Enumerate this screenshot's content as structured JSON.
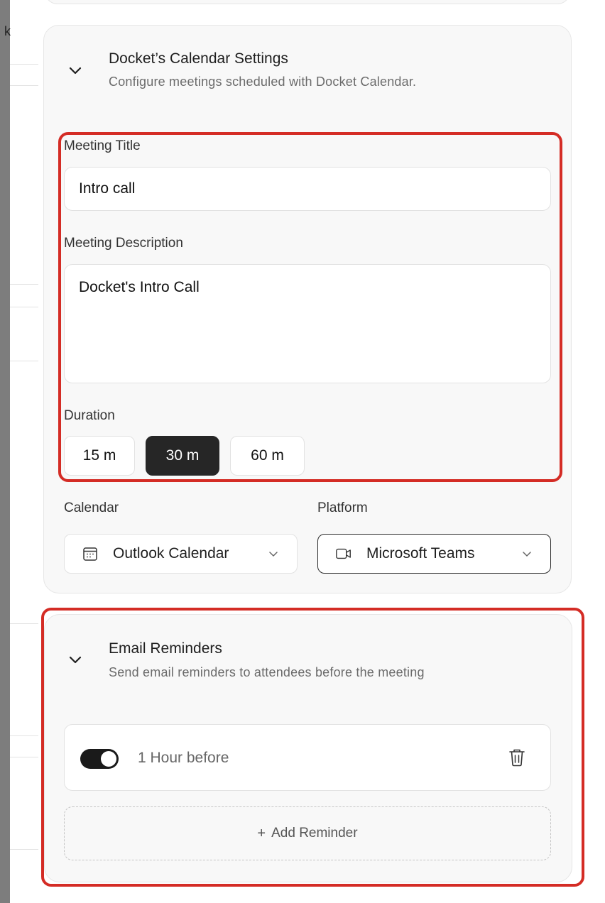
{
  "left_strip": {
    "text": "k"
  },
  "calendar_settings": {
    "title": "Docket’s Calendar Settings",
    "subtitle": "Configure meetings scheduled with Docket Calendar.",
    "meeting_title": {
      "label": "Meeting Title",
      "value": "Intro call"
    },
    "meeting_description": {
      "label": "Meeting Description",
      "value": "Docket's Intro Call"
    },
    "duration": {
      "label": "Duration",
      "options": [
        "15 m",
        "30 m",
        "60 m"
      ],
      "selected": "30 m"
    },
    "calendar": {
      "label": "Calendar",
      "value": "Outlook Calendar"
    },
    "platform": {
      "label": "Platform",
      "value": "Microsoft Teams"
    }
  },
  "email_reminders": {
    "title": "Email Reminders",
    "subtitle": "Send email reminders to attendees before the meeting",
    "reminders": [
      {
        "label": "1 Hour before",
        "enabled": true
      }
    ],
    "add_button": "Add Reminder",
    "add_button_icon": "+"
  },
  "colors": {
    "highlight": "#d42c25",
    "active_button": "#262626",
    "card_bg": "#f8f8f8"
  }
}
